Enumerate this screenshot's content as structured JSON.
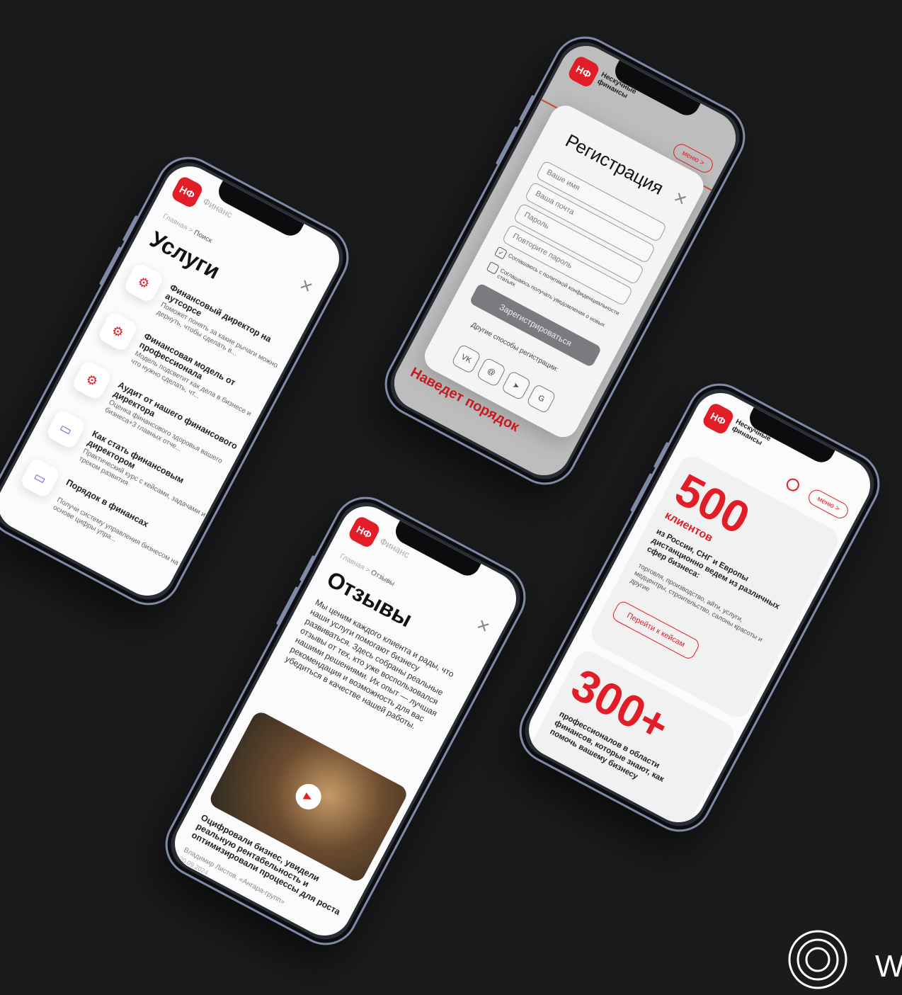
{
  "brand": {
    "logo": "НФ",
    "name": "Нескучные финансы"
  },
  "services_screen": {
    "search_value": "Финанс",
    "breadcrumb": {
      "home": "Главная",
      "sep": ">",
      "current": "Поиск"
    },
    "title": "Услуги",
    "items": [
      {
        "title": "Финансовый директор на аутсорсе",
        "desc": "Поможет понять за какие рычаги можно дернуть, чтобы сделать в..."
      },
      {
        "title": "Финансовая модель от профессионала",
        "desc": "Модель подсветит как дела в бизнесе и что нужно сделать, чт..."
      },
      {
        "title": "Аудит от нашего финансового директора",
        "desc": "Оценка финансового здоровья вашего бизнеса+3 главных отче..."
      },
      {
        "title": "Как стать финансовым директором",
        "desc": "Практический курс с кейсами, задачами и треком развития"
      },
      {
        "title": "Порядок в финансах",
        "desc": "Получи систему управления бизнесом на основе цифры упра..."
      }
    ]
  },
  "registration_screen": {
    "menu_label": "меню >",
    "title": "Регистрация",
    "fields": {
      "name": "Ваше имя",
      "email": "Ваша почта",
      "password": "Пароль",
      "password_repeat": "Повторите пароль"
    },
    "consent_policy": "Соглашаюсь с политикой конфиденциальности",
    "consent_news": "Соглашаюсь получать уведомления о новых статьях",
    "submit": "Зарегистрироваться",
    "other_methods": "Другие способы регистрации:",
    "social": [
      "VK",
      "@",
      "➤",
      "G"
    ],
    "footer_text": "Наведет порядок"
  },
  "reviews_screen": {
    "search_value": "Финанс",
    "breadcrumb": {
      "home": "Главная",
      "sep": ">",
      "current": "Отзывы"
    },
    "title": "Отзывы",
    "intro": "Мы ценим каждого клиента и рады, что наши услуги помогают бизнесу развиваться. Здесь собраны реальные отзывы от тех, кто уже воспользовался нашими решениями. Их опыт — лучшая рекомендация и возможность для вас убедиться в качестве нашей работы.",
    "review_title": "Оцифровали бизнес, увидели реальную рентабельность и оптимизировали процессы для роста",
    "review_author": "Владимир Листов, «Ангара-групп»",
    "review_date": "20.09.2024"
  },
  "stats_screen": {
    "menu_label": "меню >",
    "stat1_number": "500",
    "stat1_unit": "клиентов",
    "stat1_text": "из России, СНГ и Европы дистанционно ведем из различных сфер бизнеса:",
    "stat1_list": "торговля, производство, айти, услуги, медцентры, строительство, салоны красоты и другие",
    "stat1_button": "Перейти к кейсам",
    "stat2_number": "300+",
    "stat2_text": "профессионалов в области финансов, которые знают, как помочь вашему бизнесу"
  },
  "accent_color": "#e11d27",
  "watermark_text": "W"
}
